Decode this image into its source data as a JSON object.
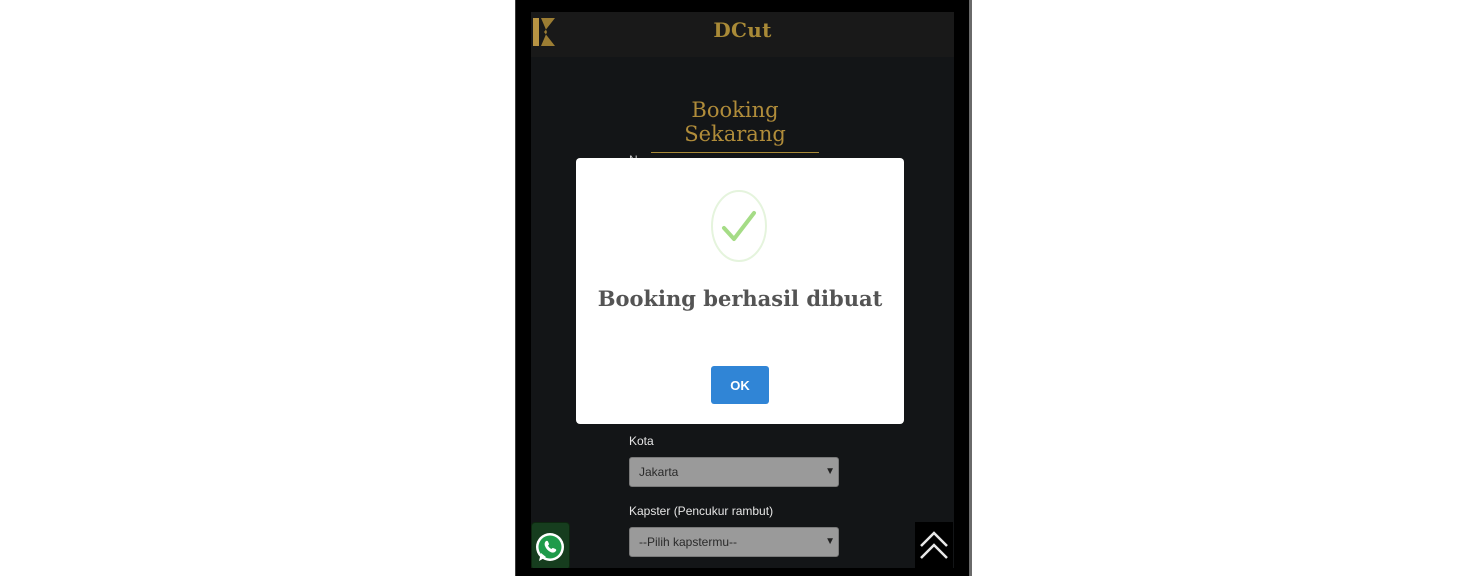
{
  "app": {
    "brand": "DCut",
    "logo_icon": "dcut-logo-icon"
  },
  "page": {
    "heading": "Booking Sekarang",
    "hidden_field_hint": "N"
  },
  "form": {
    "city_label": "Kota",
    "city_value": "Jakarta",
    "barber_label": "Kapster (Pencukur rambut)",
    "barber_placeholder": "--Pilih kapstermu--"
  },
  "floating": {
    "whatsapp_icon": "whatsapp-icon",
    "scroll_top_icon": "double-chevron-up-icon"
  },
  "modal": {
    "icon": "success-check-icon",
    "title": "Booking berhasil dibuat",
    "ok_label": "OK"
  },
  "colors": {
    "brand_gold": "#a98a37",
    "ok_blue": "#3085d6",
    "success_green": "#a5dc86",
    "screen_bg": "#131517"
  }
}
